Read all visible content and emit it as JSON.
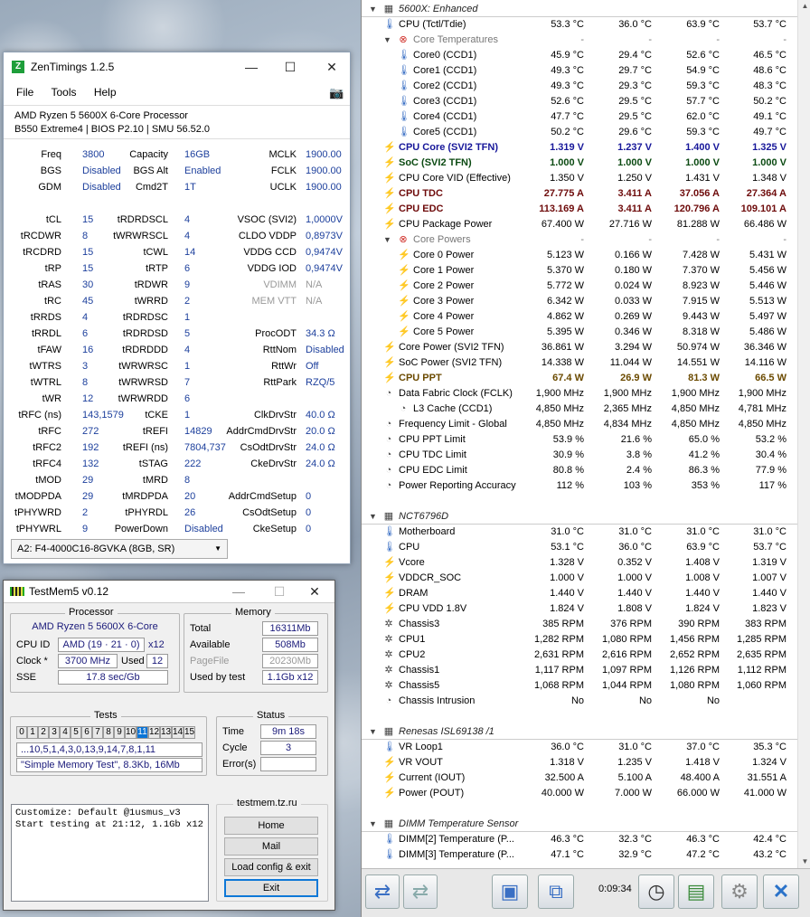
{
  "hwinfo": {
    "rows": [
      {
        "kind": "hdr",
        "name": "5600X: Enhanced",
        "icon": "chip-icon"
      },
      {
        "kind": "leaf",
        "name": "CPU (Tctl/Tdie)",
        "icon": "thermometer-icon",
        "v": [
          "53.3 °C",
          "36.0 °C",
          "63.9 °C",
          "53.7 °C"
        ]
      },
      {
        "kind": "grp",
        "name": "Core Temperatures",
        "icon": "disabled-icon",
        "v": [
          "-",
          "-",
          "-",
          "-"
        ]
      },
      {
        "kind": "sub",
        "name": "Core0 (CCD1)",
        "icon": "thermometer-icon",
        "v": [
          "45.9 °C",
          "29.4 °C",
          "52.6 °C",
          "46.5 °C"
        ]
      },
      {
        "kind": "sub",
        "name": "Core1 (CCD1)",
        "icon": "thermometer-icon",
        "v": [
          "49.3 °C",
          "29.7 °C",
          "54.9 °C",
          "48.6 °C"
        ]
      },
      {
        "kind": "sub",
        "name": "Core2 (CCD1)",
        "icon": "thermometer-icon",
        "v": [
          "49.3 °C",
          "29.3 °C",
          "59.3 °C",
          "48.3 °C"
        ]
      },
      {
        "kind": "sub",
        "name": "Core3 (CCD1)",
        "icon": "thermometer-icon",
        "v": [
          "52.6 °C",
          "29.5 °C",
          "57.7 °C",
          "50.2 °C"
        ]
      },
      {
        "kind": "sub",
        "name": "Core4 (CCD1)",
        "icon": "thermometer-icon",
        "v": [
          "47.7 °C",
          "29.5 °C",
          "62.0 °C",
          "49.1 °C"
        ]
      },
      {
        "kind": "sub",
        "name": "Core5 (CCD1)",
        "icon": "thermometer-icon",
        "v": [
          "50.2 °C",
          "29.6 °C",
          "59.3 °C",
          "49.7 °C"
        ]
      },
      {
        "kind": "leaf",
        "name": "CPU Core (SVI2 TFN)",
        "icon": "bolt-icon",
        "style": "bold blue",
        "v": [
          "1.319 V",
          "1.237 V",
          "1.400 V",
          "1.325 V"
        ]
      },
      {
        "kind": "leaf",
        "name": "SoC (SVI2 TFN)",
        "icon": "bolt-icon",
        "style": "bold green",
        "v": [
          "1.000 V",
          "1.000 V",
          "1.000 V",
          "1.000 V"
        ]
      },
      {
        "kind": "leaf",
        "name": "CPU Core VID (Effective)",
        "icon": "bolt-icon",
        "v": [
          "1.350 V",
          "1.250 V",
          "1.431 V",
          "1.348 V"
        ]
      },
      {
        "kind": "leaf",
        "name": "CPU TDC",
        "icon": "bolt-icon",
        "style": "bold darkred",
        "v": [
          "27.775 A",
          "3.411 A",
          "37.056 A",
          "27.364 A"
        ]
      },
      {
        "kind": "leaf",
        "name": "CPU EDC",
        "icon": "bolt-icon",
        "style": "bold darkred",
        "v": [
          "113.169 A",
          "3.411 A",
          "120.796 A",
          "109.101 A"
        ]
      },
      {
        "kind": "leaf",
        "name": "CPU Package Power",
        "icon": "bolt-icon",
        "v": [
          "67.400 W",
          "27.716 W",
          "81.288 W",
          "66.486 W"
        ]
      },
      {
        "kind": "grp",
        "name": "Core Powers",
        "icon": "disabled-icon",
        "v": [
          "-",
          "-",
          "-",
          "-"
        ]
      },
      {
        "kind": "sub",
        "name": "Core 0 Power",
        "icon": "bolt-icon",
        "v": [
          "5.123 W",
          "0.166 W",
          "7.428 W",
          "5.431 W"
        ]
      },
      {
        "kind": "sub",
        "name": "Core 1 Power",
        "icon": "bolt-icon",
        "v": [
          "5.370 W",
          "0.180 W",
          "7.370 W",
          "5.456 W"
        ]
      },
      {
        "kind": "sub",
        "name": "Core 2 Power",
        "icon": "bolt-icon",
        "v": [
          "5.772 W",
          "0.024 W",
          "8.923 W",
          "5.446 W"
        ]
      },
      {
        "kind": "sub",
        "name": "Core 3 Power",
        "icon": "bolt-icon",
        "v": [
          "6.342 W",
          "0.033 W",
          "7.915 W",
          "5.513 W"
        ]
      },
      {
        "kind": "sub",
        "name": "Core 4 Power",
        "icon": "bolt-icon",
        "v": [
          "4.862 W",
          "0.269 W",
          "9.443 W",
          "5.497 W"
        ]
      },
      {
        "kind": "sub",
        "name": "Core 5 Power",
        "icon": "bolt-icon",
        "v": [
          "5.395 W",
          "0.346 W",
          "8.318 W",
          "5.486 W"
        ]
      },
      {
        "kind": "leaf",
        "name": "Core Power (SVI2 TFN)",
        "icon": "bolt-icon",
        "v": [
          "36.861 W",
          "3.294 W",
          "50.974 W",
          "36.346 W"
        ]
      },
      {
        "kind": "leaf",
        "name": "SoC Power (SVI2 TFN)",
        "icon": "bolt-icon",
        "v": [
          "14.338 W",
          "11.044 W",
          "14.551 W",
          "14.116 W"
        ]
      },
      {
        "kind": "leaf",
        "name": "CPU PPT",
        "icon": "bolt-icon",
        "style": "bold brown",
        "v": [
          "67.4 W",
          "26.9 W",
          "81.3 W",
          "66.5 W"
        ]
      },
      {
        "kind": "leaf",
        "name": "Data Fabric Clock (FCLK)",
        "icon": "clock-icon",
        "v": [
          "1,900 MHz",
          "1,900 MHz",
          "1,900 MHz",
          "1,900 MHz"
        ]
      },
      {
        "kind": "sub",
        "name": "L3 Cache (CCD1)",
        "icon": "clock-icon",
        "v": [
          "4,850 MHz",
          "2,365 MHz",
          "4,850 MHz",
          "4,781 MHz"
        ]
      },
      {
        "kind": "leaf",
        "name": "Frequency Limit - Global",
        "icon": "clock-icon",
        "v": [
          "4,850 MHz",
          "4,834 MHz",
          "4,850 MHz",
          "4,850 MHz"
        ]
      },
      {
        "kind": "leaf",
        "name": "CPU PPT Limit",
        "icon": "clock-icon",
        "v": [
          "53.9 %",
          "21.6 %",
          "65.0 %",
          "53.2 %"
        ]
      },
      {
        "kind": "leaf",
        "name": "CPU TDC Limit",
        "icon": "clock-icon",
        "v": [
          "30.9 %",
          "3.8 %",
          "41.2 %",
          "30.4 %"
        ]
      },
      {
        "kind": "leaf",
        "name": "CPU EDC Limit",
        "icon": "clock-icon",
        "v": [
          "80.8 %",
          "2.4 %",
          "86.3 %",
          "77.9 %"
        ]
      },
      {
        "kind": "leaf",
        "name": "Power Reporting Accuracy",
        "icon": "clock-icon",
        "v": [
          "112 %",
          "103 %",
          "353 %",
          "117 %"
        ]
      },
      {
        "kind": "gap"
      },
      {
        "kind": "hdr",
        "name": "NCT6796D",
        "icon": "chip-icon"
      },
      {
        "kind": "leaf",
        "name": "Motherboard",
        "icon": "thermometer-icon",
        "v": [
          "31.0 °C",
          "31.0 °C",
          "31.0 °C",
          "31.0 °C"
        ]
      },
      {
        "kind": "leaf",
        "name": "CPU",
        "icon": "thermometer-icon",
        "v": [
          "53.1 °C",
          "36.0 °C",
          "63.9 °C",
          "53.7 °C"
        ]
      },
      {
        "kind": "leaf",
        "name": "Vcore",
        "icon": "bolt-icon",
        "v": [
          "1.328 V",
          "0.352 V",
          "1.408 V",
          "1.319 V"
        ]
      },
      {
        "kind": "leaf",
        "name": "VDDCR_SOC",
        "icon": "bolt-icon",
        "v": [
          "1.000 V",
          "1.000 V",
          "1.008 V",
          "1.007 V"
        ]
      },
      {
        "kind": "leaf",
        "name": "DRAM",
        "icon": "bolt-icon",
        "v": [
          "1.440 V",
          "1.440 V",
          "1.440 V",
          "1.440 V"
        ]
      },
      {
        "kind": "leaf",
        "name": "CPU VDD 1.8V",
        "icon": "bolt-icon",
        "v": [
          "1.824 V",
          "1.808 V",
          "1.824 V",
          "1.823 V"
        ]
      },
      {
        "kind": "leaf",
        "name": "Chassis3",
        "icon": "fan-icon",
        "v": [
          "385 RPM",
          "376 RPM",
          "390 RPM",
          "383 RPM"
        ]
      },
      {
        "kind": "leaf",
        "name": "CPU1",
        "icon": "fan-icon",
        "v": [
          "1,282 RPM",
          "1,080 RPM",
          "1,456 RPM",
          "1,285 RPM"
        ]
      },
      {
        "kind": "leaf",
        "name": "CPU2",
        "icon": "fan-icon",
        "v": [
          "2,631 RPM",
          "2,616 RPM",
          "2,652 RPM",
          "2,635 RPM"
        ]
      },
      {
        "kind": "leaf",
        "name": "Chassis1",
        "icon": "fan-icon",
        "v": [
          "1,117 RPM",
          "1,097 RPM",
          "1,126 RPM",
          "1,112 RPM"
        ]
      },
      {
        "kind": "leaf",
        "name": "Chassis5",
        "icon": "fan-icon",
        "v": [
          "1,068 RPM",
          "1,044 RPM",
          "1,080 RPM",
          "1,060 RPM"
        ]
      },
      {
        "kind": "leaf",
        "name": "Chassis Intrusion",
        "icon": "clock-icon",
        "v": [
          "No",
          "No",
          "No",
          ""
        ]
      },
      {
        "kind": "gap"
      },
      {
        "kind": "hdr",
        "name": "Renesas ISL69138 /1",
        "icon": "chip-icon"
      },
      {
        "kind": "leaf",
        "name": "VR Loop1",
        "icon": "thermometer-icon",
        "v": [
          "36.0 °C",
          "31.0 °C",
          "37.0 °C",
          "35.3 °C"
        ]
      },
      {
        "kind": "leaf",
        "name": "VR VOUT",
        "icon": "bolt-icon",
        "v": [
          "1.318 V",
          "1.235 V",
          "1.418 V",
          "1.324 V"
        ]
      },
      {
        "kind": "leaf",
        "name": "Current (IOUT)",
        "icon": "bolt-icon",
        "v": [
          "32.500 A",
          "5.100 A",
          "48.400 A",
          "31.551 A"
        ]
      },
      {
        "kind": "leaf",
        "name": "Power (POUT)",
        "icon": "bolt-icon",
        "v": [
          "40.000 W",
          "7.000 W",
          "66.000 W",
          "41.000 W"
        ]
      },
      {
        "kind": "gap"
      },
      {
        "kind": "hdr",
        "name": "DIMM Temperature Sensor",
        "icon": "chip-icon"
      },
      {
        "kind": "leaf",
        "name": "DIMM[2] Temperature (P...",
        "icon": "thermometer-icon",
        "v": [
          "46.3 °C",
          "32.3 °C",
          "46.3 °C",
          "42.4 °C"
        ]
      },
      {
        "kind": "leaf",
        "name": "DIMM[3] Temperature (P...",
        "icon": "thermometer-icon",
        "v": [
          "47.1 °C",
          "32.9 °C",
          "47.2 °C",
          "43.2 °C"
        ]
      }
    ],
    "toolbar": {
      "timer": "0:09:34"
    }
  },
  "zentimings": {
    "title": "ZenTimings 1.2.5",
    "menu": [
      "File",
      "Tools",
      "Help"
    ],
    "cpu": "AMD Ryzen 5 5600X 6-Core Processor",
    "board": "B550 Extreme4 | BIOS P2.10 | SMU 56.52.0",
    "rows": [
      [
        [
          "Freq",
          "3800"
        ],
        [
          "Capacity",
          "16GB"
        ],
        [
          "MCLK",
          "1900.00"
        ]
      ],
      [
        [
          "BGS",
          "Disabled"
        ],
        [
          "BGS Alt",
          "Enabled"
        ],
        [
          "FCLK",
          "1900.00"
        ]
      ],
      [
        [
          "GDM",
          "Disabled"
        ],
        [
          "Cmd2T",
          "1T"
        ],
        [
          "UCLK",
          "1900.00"
        ]
      ],
      null,
      [
        [
          "tCL",
          "15"
        ],
        [
          "tRDRDSCL",
          "4"
        ],
        [
          "VSOC (SVI2)",
          "1,0000V"
        ]
      ],
      [
        [
          "tRCDWR",
          "8"
        ],
        [
          "tWRWRSCL",
          "4"
        ],
        [
          "CLDO VDDP",
          "0,8973V"
        ]
      ],
      [
        [
          "tRCDRD",
          "15"
        ],
        [
          "tCWL",
          "14"
        ],
        [
          "VDDG CCD",
          "0,9474V"
        ]
      ],
      [
        [
          "tRP",
          "15"
        ],
        [
          "tRTP",
          "6"
        ],
        [
          "VDDG IOD",
          "0,9474V"
        ]
      ],
      [
        [
          "tRAS",
          "30"
        ],
        [
          "tRDWR",
          "9"
        ],
        [
          "VDIMM",
          "N/A"
        ]
      ],
      [
        [
          "tRC",
          "45"
        ],
        [
          "tWRRD",
          "2"
        ],
        [
          "MEM VTT",
          "N/A"
        ]
      ],
      [
        [
          "tRRDS",
          "4"
        ],
        [
          "tRDRDSC",
          "1"
        ],
        [
          "",
          ""
        ]
      ],
      [
        [
          "tRRDL",
          "6"
        ],
        [
          "tRDRDSD",
          "5"
        ],
        [
          "ProcODT",
          "34.3 Ω"
        ]
      ],
      [
        [
          "tFAW",
          "16"
        ],
        [
          "tRDRDDD",
          "4"
        ],
        [
          "RttNom",
          "Disabled"
        ]
      ],
      [
        [
          "tWTRS",
          "3"
        ],
        [
          "tWRWRSC",
          "1"
        ],
        [
          "RttWr",
          "Off"
        ]
      ],
      [
        [
          "tWTRL",
          "8"
        ],
        [
          "tWRWRSD",
          "7"
        ],
        [
          "RttPark",
          "RZQ/5"
        ]
      ],
      [
        [
          "tWR",
          "12"
        ],
        [
          "tWRWRDD",
          "6"
        ],
        [
          "",
          ""
        ]
      ],
      [
        [
          "tRFC (ns)",
          "143,1579"
        ],
        [
          "tCKE",
          "1"
        ],
        [
          "ClkDrvStr",
          "40.0 Ω"
        ]
      ],
      [
        [
          "tRFC",
          "272"
        ],
        [
          "tREFI",
          "14829"
        ],
        [
          "AddrCmdDrvStr",
          "20.0 Ω"
        ]
      ],
      [
        [
          "tRFC2",
          "192"
        ],
        [
          "tREFI (ns)",
          "7804,737"
        ],
        [
          "CsOdtDrvStr",
          "24.0 Ω"
        ]
      ],
      [
        [
          "tRFC4",
          "132"
        ],
        [
          "tSTAG",
          "222"
        ],
        [
          "CkeDrvStr",
          "24.0 Ω"
        ]
      ],
      [
        [
          "tMOD",
          "29"
        ],
        [
          "tMRD",
          "8"
        ],
        [
          "",
          ""
        ]
      ],
      [
        [
          "tMODPDA",
          "29"
        ],
        [
          "tMRDPDA",
          "20"
        ],
        [
          "AddrCmdSetup",
          "0"
        ]
      ],
      [
        [
          "tPHYWRD",
          "2"
        ],
        [
          "tPHYRDL",
          "26"
        ],
        [
          "CsOdtSetup",
          "0"
        ]
      ],
      [
        [
          "tPHYWRL",
          "9"
        ],
        [
          "PowerDown",
          "Disabled"
        ],
        [
          "CkeSetup",
          "0"
        ]
      ]
    ],
    "module": "A2: F4-4000C16-8GVKA (8GB, SR)"
  },
  "testmem": {
    "title": "TestMem5 v0.12",
    "processor_caption": "Processor",
    "cpu_name": "AMD Ryzen 5 5600X 6-Core",
    "cpuid_label": "CPU ID",
    "cpuid": "AMD  (19 · 21 · 0)",
    "cpuid_x": "x12",
    "clock_label": "Clock *",
    "clock": "3700 MHz",
    "used_label": "Used",
    "used": "12",
    "sse_label": "SSE",
    "sse": "17.8 sec/Gb",
    "memory_caption": "Memory",
    "total_label": "Total",
    "total": "16311Mb",
    "avail_label": "Available",
    "avail": "508Mb",
    "pagefile_label": "PageFile",
    "pagefile": "20230Mb",
    "usedby_label": "Used by test",
    "usedby": "1.1Gb x12",
    "tests_caption": "Tests",
    "tests": [
      "0",
      "1",
      "2",
      "3",
      "4",
      "5",
      "6",
      "7",
      "8",
      "9",
      "10",
      "11",
      "12",
      "13",
      "14",
      "15"
    ],
    "current_test": 11,
    "sequence": "...10,5,1,4,3,0,13,9,14,7,8,1,11",
    "test_desc": "\"Simple Memory Test\", 8.3Kb, 16Mb",
    "status_caption": "Status",
    "time_label": "Time",
    "time": "9m 18s",
    "cycle_label": "Cycle",
    "cycle": "3",
    "errors_label": "Error(s)",
    "errors": "",
    "log": [
      "Customize: Default @1usmus_v3",
      "Start testing at 21:12, 1.1Gb x12"
    ],
    "site": "testmem.tz.ru",
    "buttons": {
      "home": "Home",
      "mail": "Mail",
      "load": "Load config & exit",
      "exit": "Exit"
    }
  },
  "colors": {
    "value_blue": "#1c3f9c",
    "accent": "#0a74d6"
  }
}
